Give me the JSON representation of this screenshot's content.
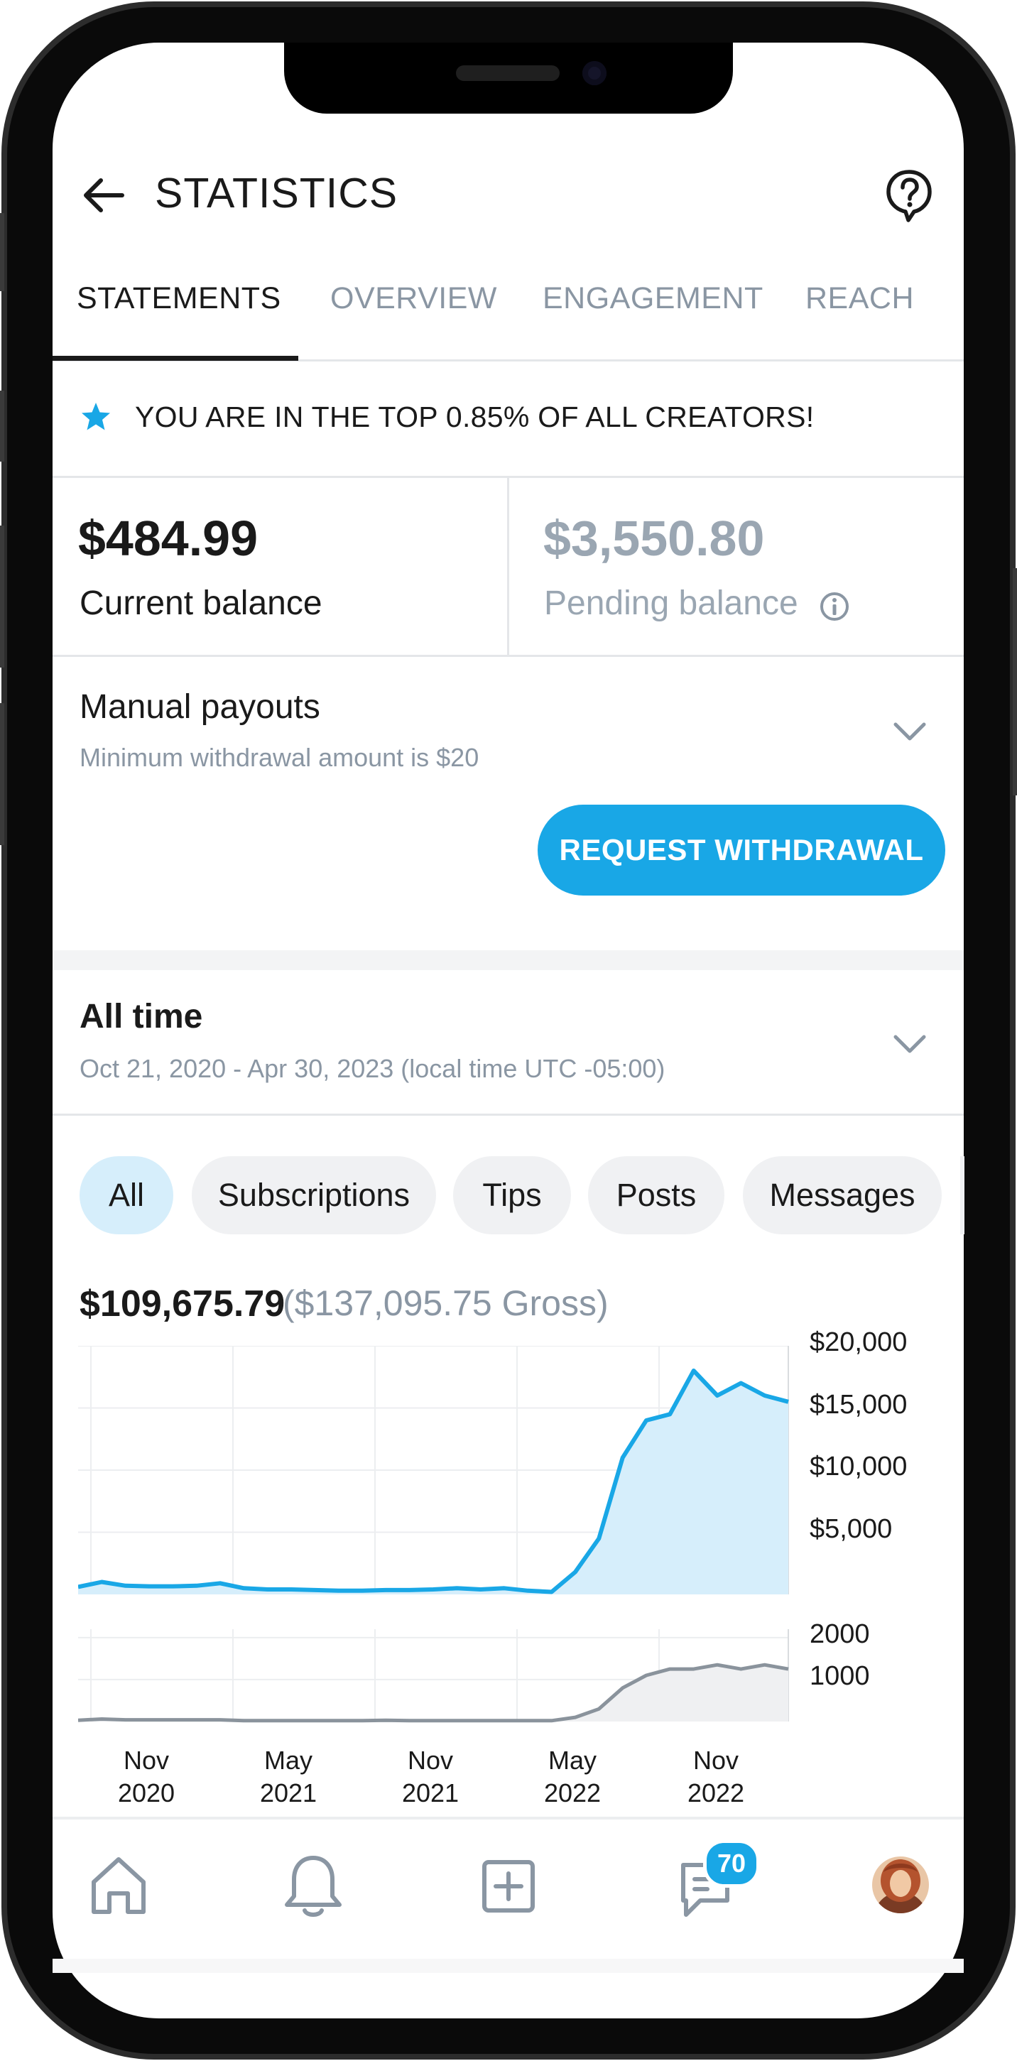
{
  "header": {
    "title": "STATISTICS"
  },
  "tabs": [
    {
      "label": "STATEMENTS",
      "active": true
    },
    {
      "label": "OVERVIEW",
      "active": false
    },
    {
      "label": "ENGAGEMENT",
      "active": false
    },
    {
      "label": "REACH",
      "active": false
    }
  ],
  "banner": {
    "text": "YOU ARE IN THE TOP 0.85% OF ALL CREATORS!",
    "icon": "star-icon"
  },
  "balances": {
    "current_amount": "$484.99",
    "current_label": "Current balance",
    "pending_amount": "$3,550.80",
    "pending_label": "Pending balance"
  },
  "payouts": {
    "title": "Manual payouts",
    "subtitle": "Minimum withdrawal amount is $20",
    "button": "REQUEST WITHDRAWAL"
  },
  "period": {
    "title": "All time",
    "range": "Oct 21, 2020 - Apr 30, 2023 (local time UTC -05:00)"
  },
  "filters": [
    "All",
    "Subscriptions",
    "Tips",
    "Posts",
    "Messages"
  ],
  "totals": {
    "net": "$109,675.79",
    "gross": "($137,095.75 Gross)"
  },
  "bottom_nav": {
    "messages_badge": "70"
  },
  "colors": {
    "accent": "#19a7e6",
    "area_fill": "#d6eefb",
    "secondary_line": "#8a939c"
  },
  "chart_data": [
    {
      "type": "area",
      "x": [
        "Oct 2020",
        "Nov 2020",
        "Dec 2020",
        "Jan 2021",
        "Feb 2021",
        "Mar 2021",
        "Apr 2021",
        "May 2021",
        "Jun 2021",
        "Jul 2021",
        "Aug 2021",
        "Sep 2021",
        "Oct 2021",
        "Nov 2021",
        "Dec 2021",
        "Jan 2022",
        "Feb 2022",
        "Mar 2022",
        "Apr 2022",
        "May 2022",
        "Jun 2022",
        "Jul 2022",
        "Aug 2022",
        "Sep 2022",
        "Oct 2022",
        "Nov 2022",
        "Dec 2022",
        "Jan 2023",
        "Feb 2023",
        "Mar 2023",
        "Apr 2023"
      ],
      "series": [
        {
          "values": [
            600,
            1000,
            700,
            650,
            650,
            700,
            900,
            500,
            400,
            400,
            350,
            300,
            300,
            350,
            350,
            400,
            500,
            400,
            500,
            300,
            200,
            1800,
            4500,
            11000,
            14000,
            14500,
            18000,
            16000,
            17000,
            16000,
            15500
          ]
        }
      ],
      "ylim": [
        0,
        20000
      ],
      "yticks": [
        "$5,000",
        "$10,000",
        "$15,000",
        "$20,000"
      ],
      "ytick_values": [
        5000,
        10000,
        15000,
        20000
      ],
      "grid": true
    },
    {
      "type": "line",
      "x": [
        "Oct 2020",
        "Nov 2020",
        "Dec 2020",
        "Jan 2021",
        "Feb 2021",
        "Mar 2021",
        "Apr 2021",
        "May 2021",
        "Jun 2021",
        "Jul 2021",
        "Aug 2021",
        "Sep 2021",
        "Oct 2021",
        "Nov 2021",
        "Dec 2021",
        "Jan 2022",
        "Feb 2022",
        "Mar 2022",
        "Apr 2022",
        "May 2022",
        "Jun 2022",
        "Jul 2022",
        "Aug 2022",
        "Sep 2022",
        "Oct 2022",
        "Nov 2022",
        "Dec 2022",
        "Jan 2023",
        "Feb 2023",
        "Mar 2023",
        "Apr 2023"
      ],
      "series": [
        {
          "values": [
            30,
            60,
            40,
            40,
            40,
            40,
            40,
            20,
            20,
            20,
            20,
            20,
            20,
            30,
            20,
            20,
            20,
            20,
            20,
            20,
            20,
            100,
            300,
            800,
            1100,
            1250,
            1250,
            1350,
            1250,
            1350,
            1250
          ]
        }
      ],
      "ylim": [
        0,
        2200
      ],
      "yticks": [
        "1000",
        "2000"
      ],
      "ytick_values": [
        1000,
        2000
      ],
      "grid": true
    }
  ],
  "x_axis_labels": [
    {
      "month": "Nov",
      "year": "2020"
    },
    {
      "month": "May",
      "year": "2021"
    },
    {
      "month": "Nov",
      "year": "2021"
    },
    {
      "month": "May",
      "year": "2022"
    },
    {
      "month": "Nov",
      "year": "2022"
    }
  ]
}
